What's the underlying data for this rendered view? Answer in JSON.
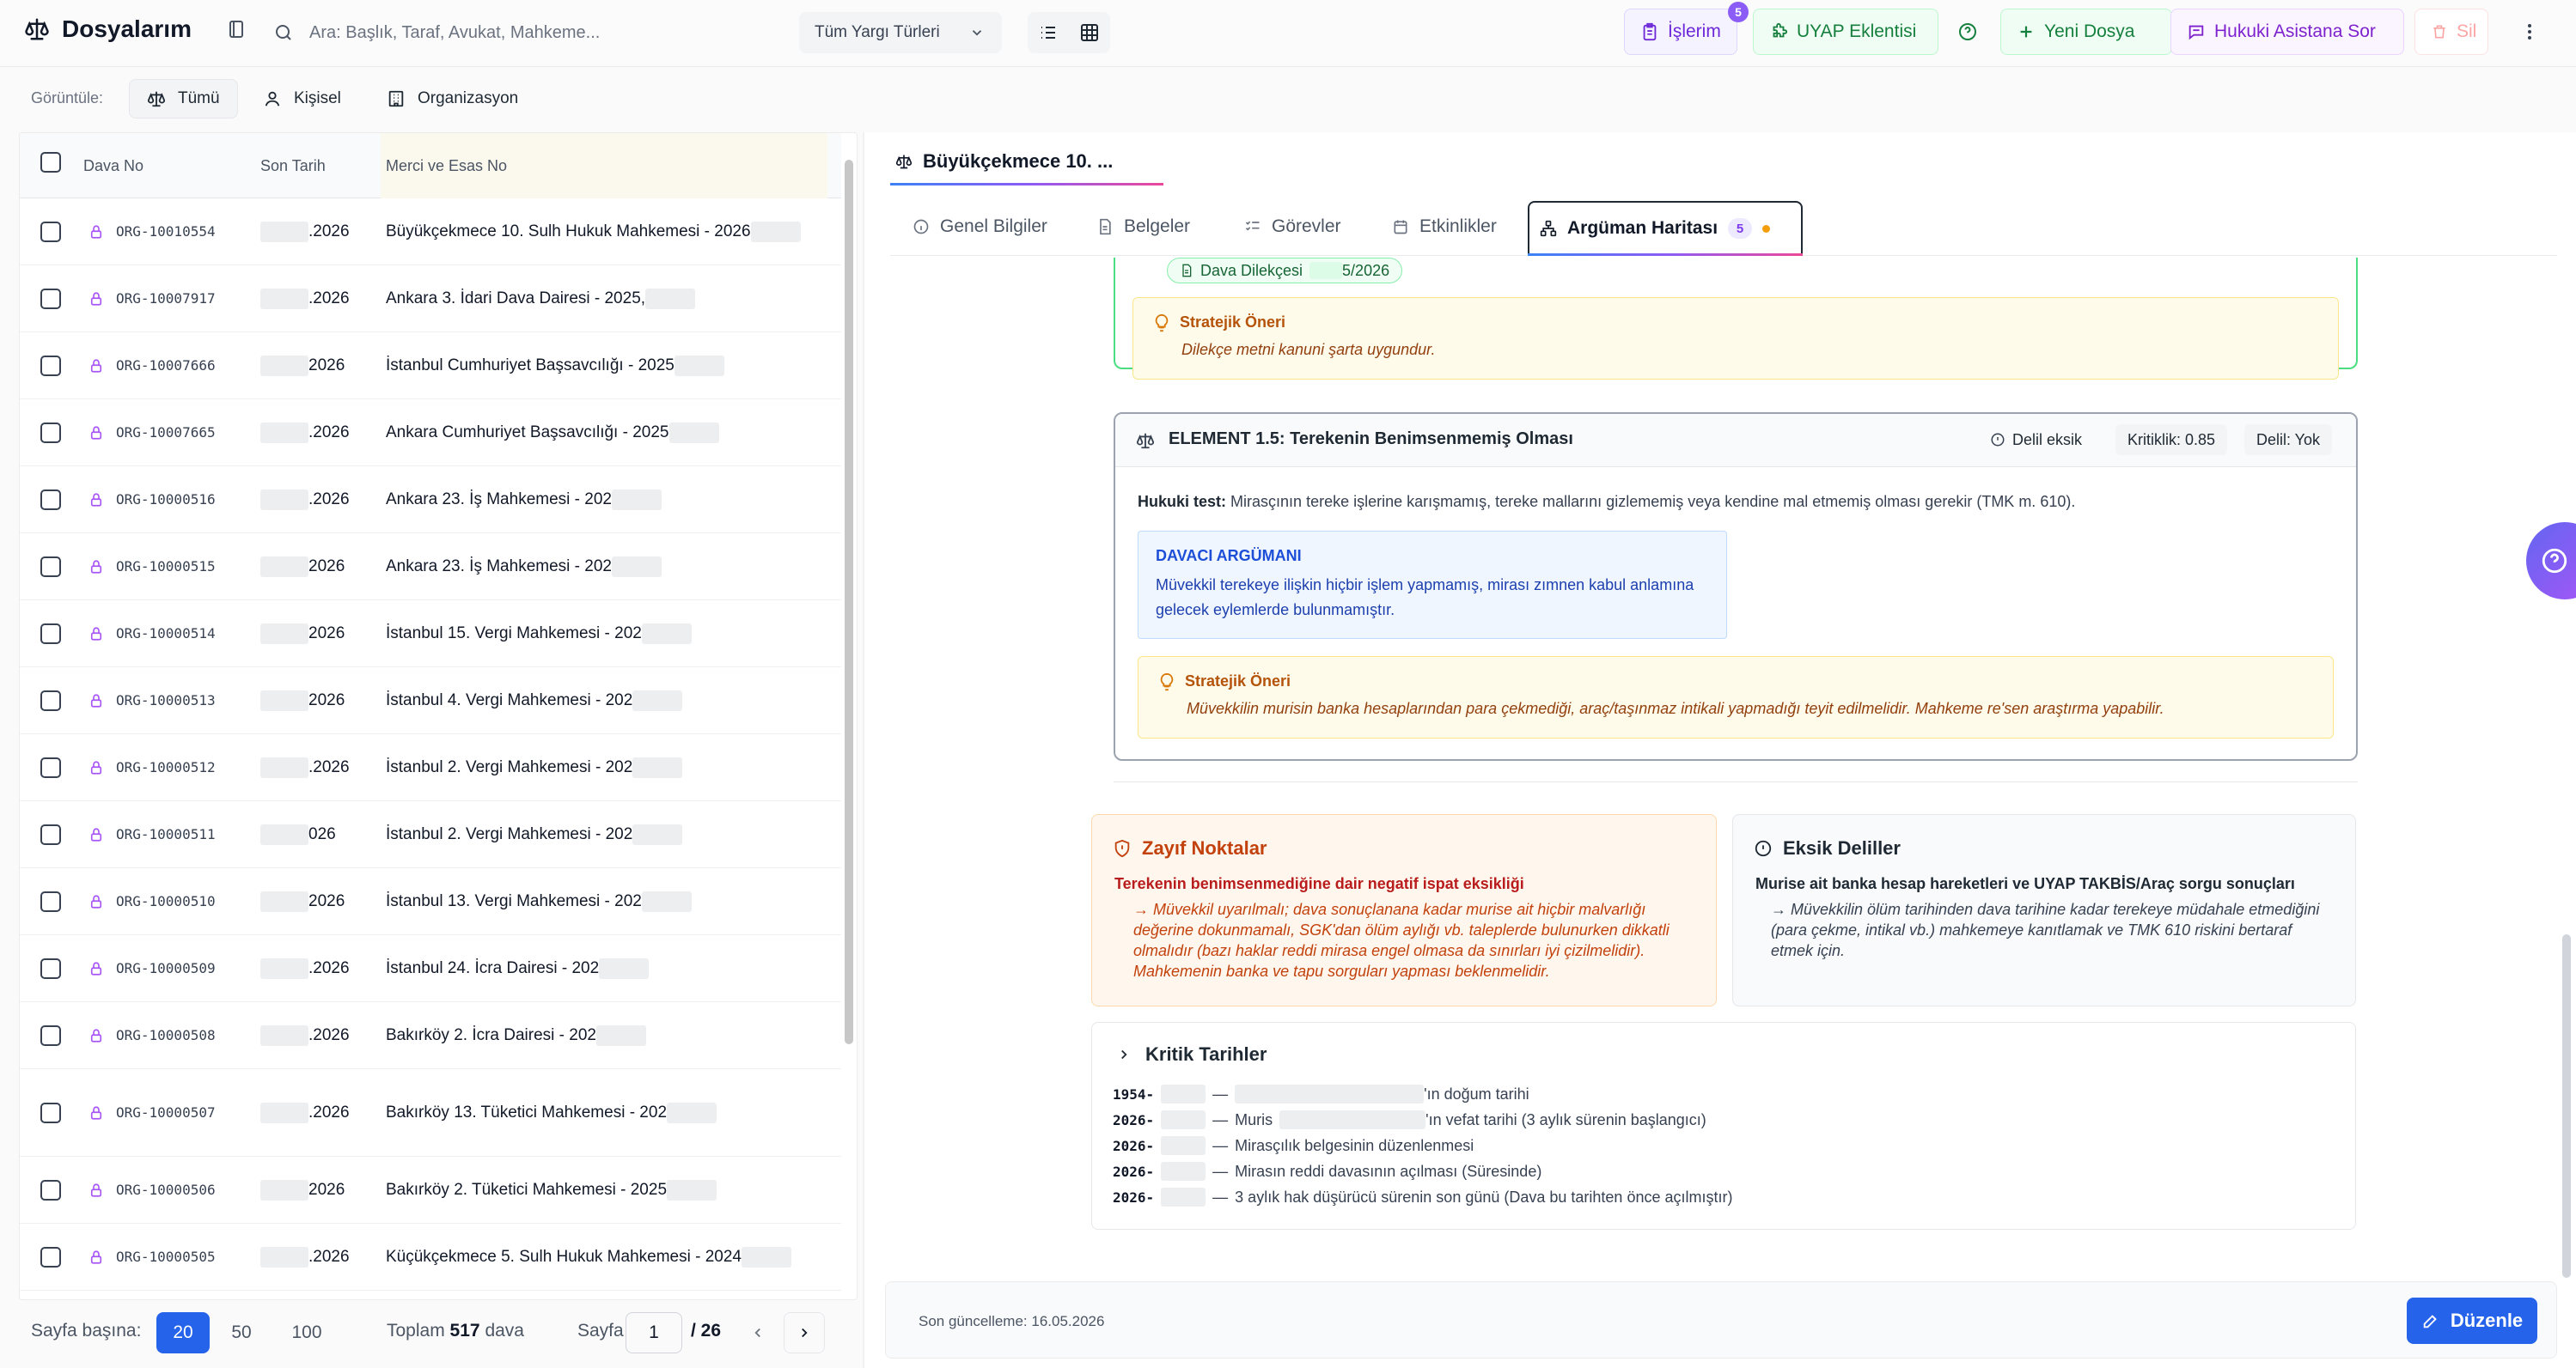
{
  "app": {
    "title": "Dosyalarım",
    "search_placeholder": "Ara: Başlık, Taraf, Avukat, Mahkeme...",
    "jurisdiction_select": "Tüm Yargı Türleri"
  },
  "toolbar": {
    "islerim_label": "İşlerim",
    "islerim_badge": "5",
    "uyap_label": "UYAP Eklentisi",
    "new_file_label": "Yeni Dosya",
    "assistant_label": "Hukuki Asistana Sor",
    "delete_label": "Sil"
  },
  "filters": {
    "label": "Görüntüle:",
    "options": [
      "Tümü",
      "Kişisel",
      "Organizasyon"
    ]
  },
  "table": {
    "columns": [
      "Dava No",
      "Son Tarih",
      "Merci ve Esas No"
    ],
    "rows": [
      {
        "no": "ORG-10010554",
        "date": ".2026",
        "court": "Büyükçekmece 10. Sulh Hukuk Mahkemesi - 2026"
      },
      {
        "no": "ORG-10007917",
        "date": ".2026",
        "court": "Ankara 3. İdari Dava Dairesi - 2025,"
      },
      {
        "no": "ORG-10007666",
        "date": "2026",
        "court": "İstanbul Cumhuriyet Başsavcılığı - 2025"
      },
      {
        "no": "ORG-10007665",
        "date": ".2026",
        "court": "Ankara Cumhuriyet Başsavcılığı - 2025"
      },
      {
        "no": "ORG-10000516",
        "date": ".2026",
        "court": "Ankara 23. İş Mahkemesi - 202"
      },
      {
        "no": "ORG-10000515",
        "date": "2026",
        "court": "Ankara 23. İş Mahkemesi - 202"
      },
      {
        "no": "ORG-10000514",
        "date": "2026",
        "court": "İstanbul 15. Vergi Mahkemesi - 202"
      },
      {
        "no": "ORG-10000513",
        "date": "2026",
        "court": "İstanbul 4. Vergi Mahkemesi - 202"
      },
      {
        "no": "ORG-10000512",
        "date": ".2026",
        "court": "İstanbul 2. Vergi Mahkemesi - 202"
      },
      {
        "no": "ORG-10000511",
        "date": "026",
        "court": "İstanbul 2. Vergi Mahkemesi - 202"
      },
      {
        "no": "ORG-10000510",
        "date": "2026",
        "court": "İstanbul 13. Vergi Mahkemesi - 202"
      },
      {
        "no": "ORG-10000509",
        "date": ".2026",
        "court": "İstanbul 24. İcra Dairesi - 202"
      },
      {
        "no": "ORG-10000508",
        "date": ".2026",
        "court": "Bakırköy 2. İcra Dairesi - 202"
      },
      {
        "no": "ORG-10000507",
        "date": ".2026",
        "court": "Bakırköy 13. Tüketici Mahkemesi - 202"
      },
      {
        "no": "ORG-10000506",
        "date": "2026",
        "court": "Bakırköy 2. Tüketici Mahkemesi - 2025"
      },
      {
        "no": "ORG-10000505",
        "date": ".2026",
        "court": "Küçükçekmece 5. Sulh Hukuk Mahkemesi - 2024"
      }
    ]
  },
  "pager": {
    "per_page_label": "Sayfa başına:",
    "sizes": [
      "20",
      "50",
      "100"
    ],
    "total_prefix": "Toplam",
    "total_count": "517",
    "total_suffix": "dava",
    "page_label": "Sayfa",
    "current_page": "1",
    "total_pages": "/ 26"
  },
  "detail": {
    "doc_tab": "Büyükçekmece 10. ...",
    "tabs": [
      "Genel Bilgiler",
      "Belgeler",
      "Görevler",
      "Etkinlikler",
      "Argüman Haritası"
    ],
    "argument_badge": "5",
    "source_chip_prefix": "Dava Dilekçesi",
    "source_chip_suffix": "5/2026",
    "strategy_title": "Stratejik Öneri",
    "strategy_text_1": "Dilekçe metni kanuni şarta uygundur.",
    "element": {
      "title": "ELEMENT 1.5: Terekenin Benimsenmemiş Olması",
      "evidence_status": "Delil eksik",
      "criticality": "Kritiklik: 0.85",
      "evidence": "Delil: Yok",
      "legal_test_label": "Hukuki test:",
      "legal_test_text": "Mirasçının tereke işlerine karışmamış, tereke mallarını gizlememiş veya kendine mal etmemiş olması gerekir (TMK m. 610).",
      "plaintiff_title": "DAVACI ARGÜMANI",
      "plaintiff_text": "Müvekkil terekeye ilişkin hiçbir işlem yapmamış, mirası zımnen kabul anlamına gelecek eylemlerde bulunmamıştır.",
      "strategy_text": "Müvekkilin murisin banka hesaplarından para çekmediği, araç/taşınmaz intikali yapmadığı teyit edilmelidir. Mahkeme re'sen araştırma yapabilir."
    },
    "weak": {
      "title": "Zayıf Noktalar",
      "subtitle": "Terekenin benimsenmediğine dair negatif ispat eksikliği",
      "text": "→ Müvekkil uyarılmalı; dava sonuçlanana kadar murise ait hiçbir malvarlığı değerine dokunmamalı, SGK'dan ölüm aylığı vb. taleplerde bulunurken dikkatli olmalıdır (bazı haklar reddi mirasa engel olmasa da sınırları iyi çizilmelidir). Mahkemenin banka ve tapu sorguları yapması beklenmelidir."
    },
    "missing": {
      "title": "Eksik Deliller",
      "subtitle": "Murise ait banka hesap hareketleri ve UYAP TAKBİS/Araç sorgu sonuçları",
      "text": "→ Müvekkilin ölüm tarihinden dava tarihine kadar terekeye müdahale etmediğini (para çekme, intikal vb.) mahkemeye kanıtlamak ve TMK 610 riskini bertaraf etmek için."
    },
    "dates": {
      "title": "Kritik Tarihler",
      "rows": [
        {
          "year": "1954-",
          "text": "'ın doğum tarihi",
          "prefix": ""
        },
        {
          "year": "2026-",
          "text": "'ın vefat tarihi (3 aylık sürenin başlangıcı)",
          "prefix": "Muris"
        },
        {
          "year": "2026-",
          "text": "Mirasçılık belgesinin düzenlenmesi",
          "prefix": ""
        },
        {
          "year": "2026-",
          "text": "Mirasın reddi davasının açılması (Süresinde)",
          "prefix": ""
        },
        {
          "year": "2026-",
          "text": "3 aylık hak düşürücü sürenin son günü (Dava bu tarihten önce açılmıştır)",
          "prefix": ""
        }
      ]
    },
    "footer_updated": "Son güncelleme: 16.05.2026",
    "edit_label": "Düzenle"
  }
}
